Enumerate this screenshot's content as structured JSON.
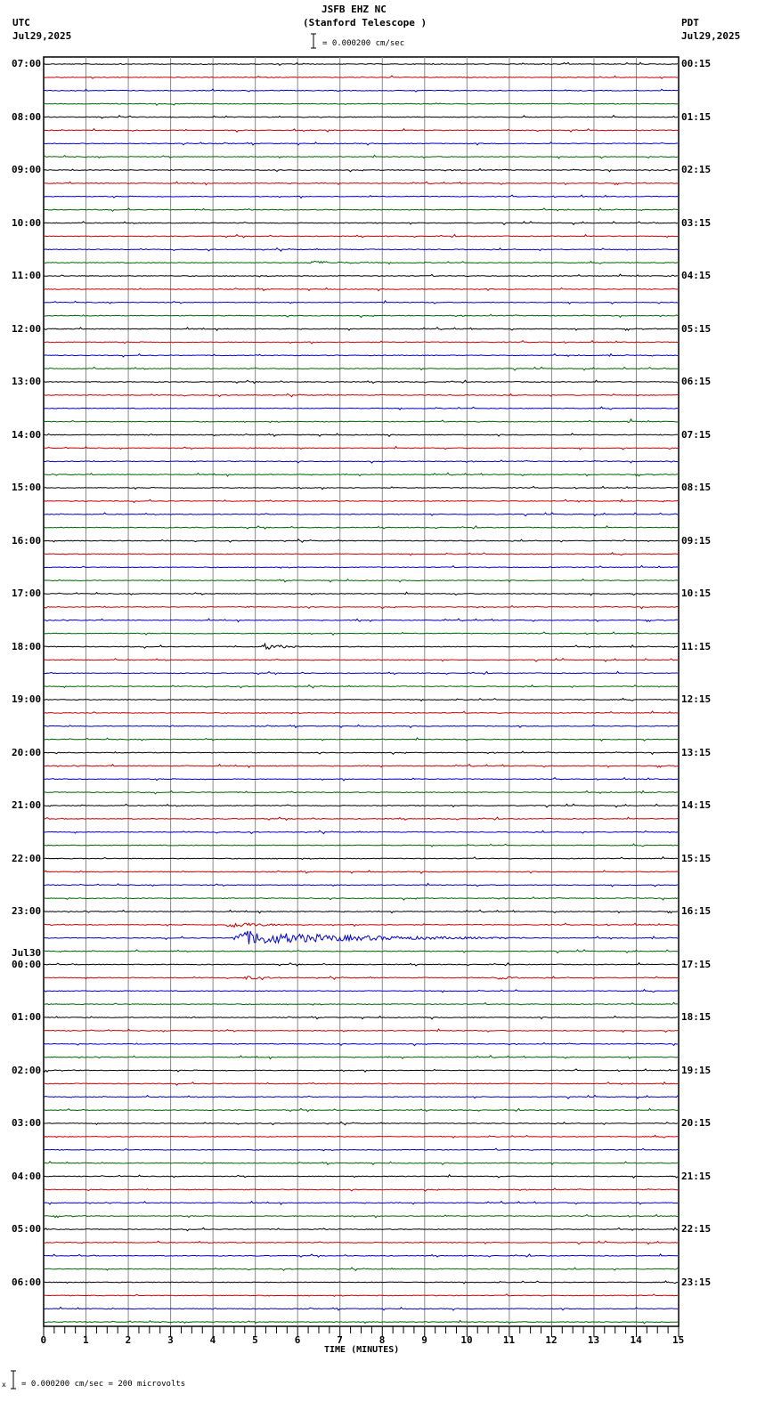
{
  "header": {
    "title": "JSFB EHZ NC",
    "subtitle": "(Stanford Telescope )",
    "left_tz": "UTC",
    "left_date": "Jul29,2025",
    "right_tz": "PDT",
    "right_date": "Jul29,2025",
    "scale": "= 0.000200 cm/sec"
  },
  "footer": {
    "scale": "= 0.000200 cm/sec =     200 microvolts",
    "mark": "x"
  },
  "chart_data": {
    "type": "line",
    "title": "JSFB EHZ NC (Stanford Telescope )",
    "xlabel": "TIME (MINUTES)",
    "xlim": [
      0,
      15
    ],
    "x_ticks": [
      "0",
      "1",
      "2",
      "3",
      "4",
      "5",
      "6",
      "7",
      "8",
      "9",
      "10",
      "11",
      "12",
      "13",
      "14",
      "15"
    ],
    "traces_per_hour": 4,
    "trace_count": 96,
    "trace_colors": [
      "#000000",
      "#cc0000",
      "#0000cc",
      "#006600"
    ],
    "date_change_label": "Jul30",
    "left_labels": [
      "07:00",
      "08:00",
      "09:00",
      "10:00",
      "11:00",
      "12:00",
      "13:00",
      "14:00",
      "15:00",
      "16:00",
      "17:00",
      "18:00",
      "19:00",
      "20:00",
      "21:00",
      "22:00",
      "23:00",
      "00:00",
      "01:00",
      "02:00",
      "03:00",
      "04:00",
      "05:00",
      "06:00"
    ],
    "right_labels": [
      "00:15",
      "01:15",
      "02:15",
      "03:15",
      "04:15",
      "05:15",
      "06:15",
      "07:15",
      "08:15",
      "09:15",
      "10:15",
      "11:15",
      "12:15",
      "13:15",
      "14:15",
      "15:15",
      "16:15",
      "17:15",
      "18:15",
      "19:15",
      "20:15",
      "21:15",
      "22:15",
      "23:15"
    ],
    "events": [
      {
        "trace": 15,
        "start": 6.2,
        "duration": 2.0,
        "amp": 2
      },
      {
        "trace": 27,
        "start": 13.8,
        "duration": 0.3,
        "amp": 2
      },
      {
        "trace": 28,
        "start": 4.0,
        "duration": 0.2,
        "amp": 2
      },
      {
        "trace": 29,
        "start": 4.8,
        "duration": 0.3,
        "amp": 2
      },
      {
        "trace": 41,
        "start": 4.8,
        "duration": 0.1,
        "amp": 2
      },
      {
        "trace": 41,
        "start": 12.1,
        "duration": 0.1,
        "amp": 2
      },
      {
        "trace": 42,
        "start": 7.4,
        "duration": 0.2,
        "amp": 4
      },
      {
        "trace": 44,
        "start": 5.1,
        "duration": 1.0,
        "amp": 5
      },
      {
        "trace": 65,
        "start": 4.3,
        "duration": 1.9,
        "amp": 4
      },
      {
        "trace": 66,
        "start": 4.4,
        "duration": 7.0,
        "amp": 9
      },
      {
        "trace": 69,
        "start": 4.7,
        "duration": 1.4,
        "amp": 2
      },
      {
        "trace": 69,
        "start": 10.7,
        "duration": 0.8,
        "amp": 2
      }
    ]
  }
}
